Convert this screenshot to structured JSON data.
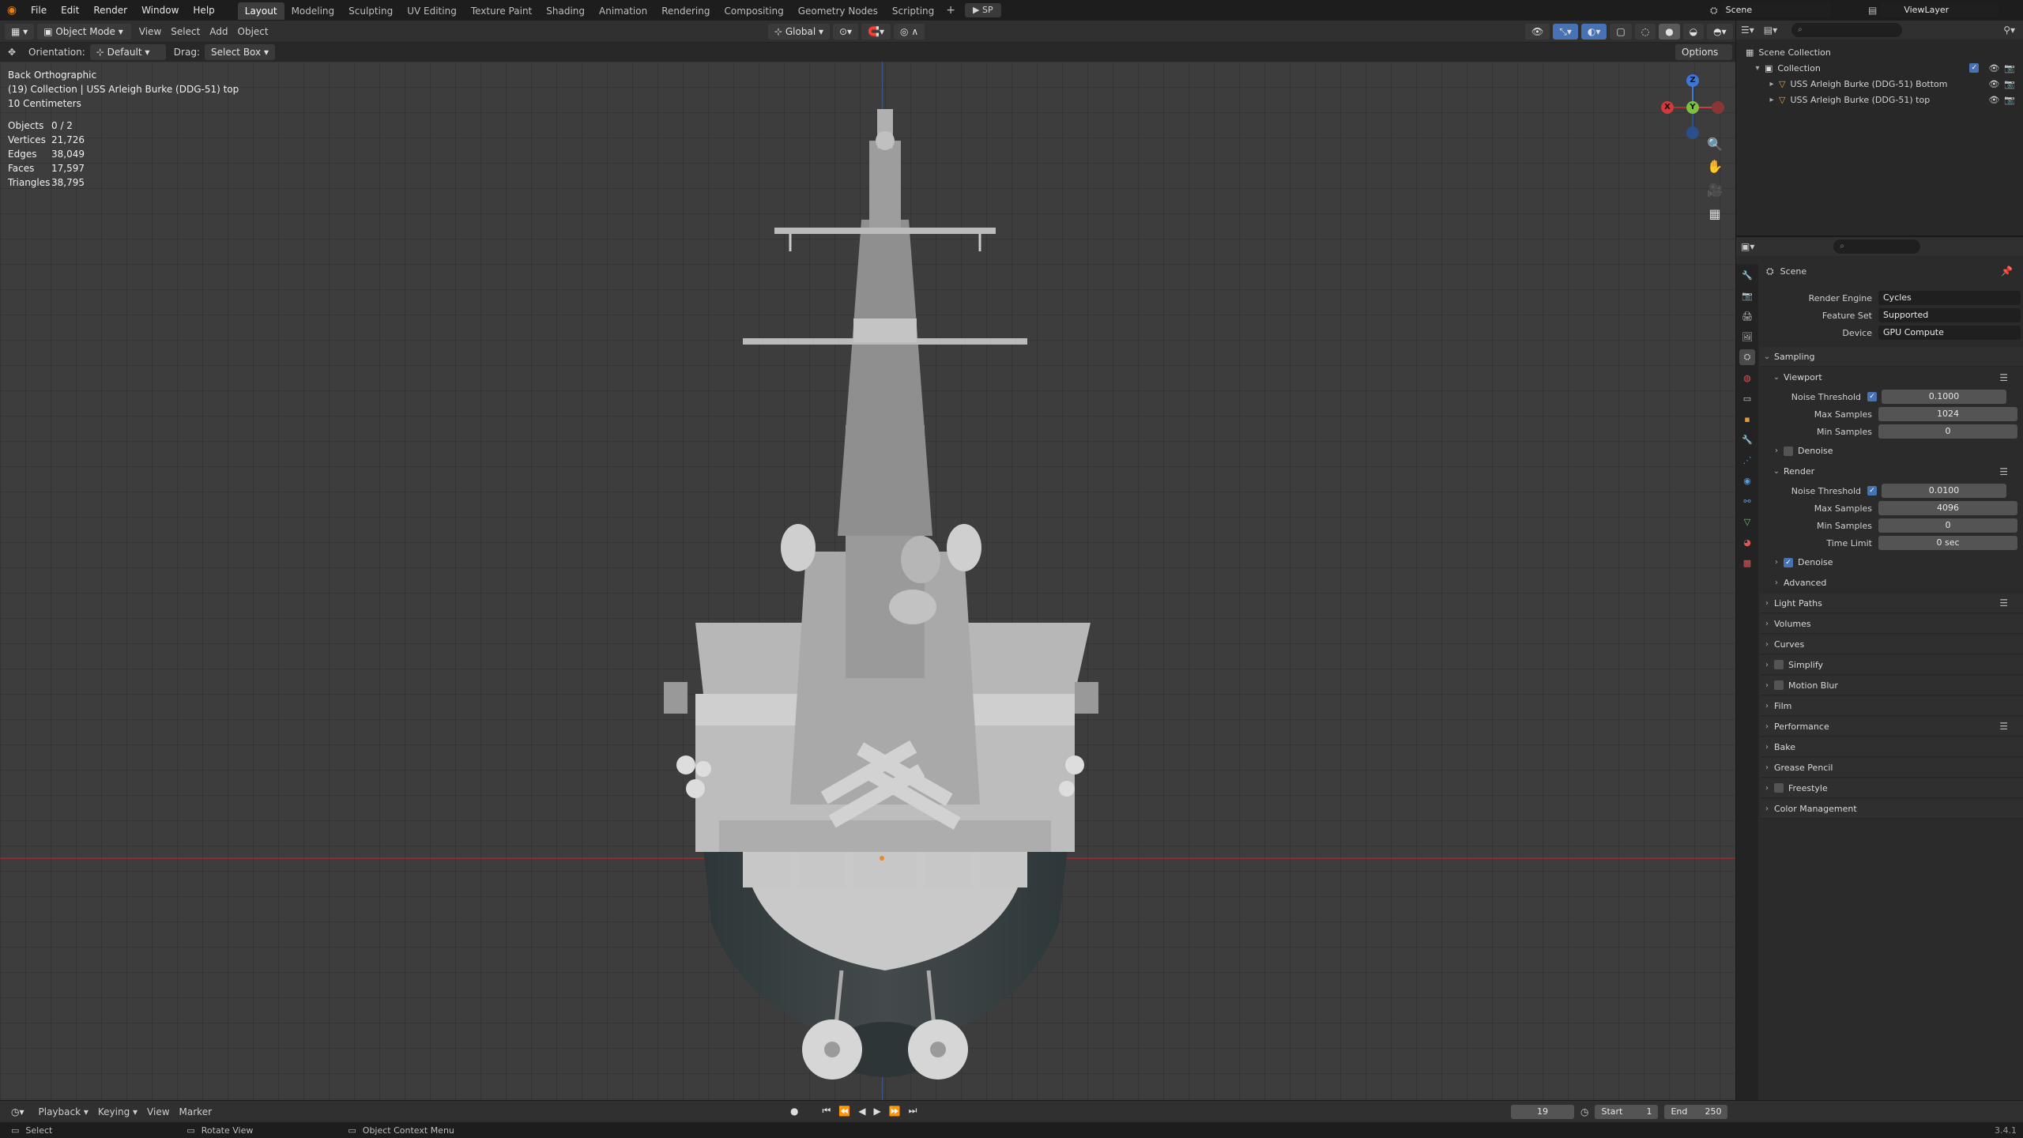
{
  "menu": [
    "File",
    "Edit",
    "Render",
    "Window",
    "Help"
  ],
  "workspaces": [
    "Layout",
    "Modeling",
    "Sculpting",
    "UV Editing",
    "Texture Paint",
    "Shading",
    "Animation",
    "Rendering",
    "Compositing",
    "Geometry Nodes",
    "Scripting"
  ],
  "active_workspace": "Layout",
  "top_right": {
    "scene": "Scene",
    "viewlayer": "ViewLayer",
    "sp_label": "SP"
  },
  "header": {
    "mode": "Object Mode",
    "view": "View",
    "select": "Select",
    "add": "Add",
    "object": "Object",
    "transform": "Global",
    "options": "Options"
  },
  "tool": {
    "orientation_label": "Orientation:",
    "orientation_value": "Default",
    "drag_label": "Drag:",
    "drag_value": "Select Box"
  },
  "overlay": {
    "view_name": "Back Orthographic",
    "collection": "(19) Collection | USS Arleigh Burke (DDG-51) top",
    "scale": "10 Centimeters",
    "stats": [
      {
        "k": "Objects",
        "v": "0 / 2"
      },
      {
        "k": "Vertices",
        "v": "21,726"
      },
      {
        "k": "Edges",
        "v": "38,049"
      },
      {
        "k": "Faces",
        "v": "17,597"
      },
      {
        "k": "Triangles",
        "v": "38,795"
      }
    ]
  },
  "gizmo": {
    "z": "Z",
    "y": "Y",
    "x": "X"
  },
  "outliner": {
    "root": "Scene Collection",
    "collection": "Collection",
    "items": [
      "USS Arleigh Burke (DDG-51) Bottom",
      "USS Arleigh Burke (DDG-51) top"
    ]
  },
  "props": {
    "context": "Scene",
    "render_engine": {
      "label": "Render Engine",
      "value": "Cycles"
    },
    "feature_set": {
      "label": "Feature Set",
      "value": "Supported"
    },
    "device": {
      "label": "Device",
      "value": "GPU Compute"
    },
    "sampling": "Sampling",
    "viewport": "Viewport",
    "vp_noise": {
      "label": "Noise Threshold",
      "value": "0.1000"
    },
    "vp_max": {
      "label": "Max Samples",
      "value": "1024"
    },
    "vp_min": {
      "label": "Min Samples",
      "value": "0"
    },
    "denoise1": "Denoise",
    "render": "Render",
    "r_noise": {
      "label": "Noise Threshold",
      "value": "0.0100"
    },
    "r_max": {
      "label": "Max Samples",
      "value": "4096"
    },
    "r_min": {
      "label": "Min Samples",
      "value": "0"
    },
    "r_time": {
      "label": "Time Limit",
      "value": "0 sec"
    },
    "denoise2": "Denoise",
    "advanced": "Advanced",
    "panels": [
      "Light Paths",
      "Volumes",
      "Curves",
      "Simplify",
      "Motion Blur",
      "Film",
      "Performance",
      "Bake",
      "Grease Pencil",
      "Freestyle",
      "Color Management"
    ]
  },
  "timeline": {
    "playback": "Playback",
    "keying": "Keying",
    "view": "View",
    "marker": "Marker",
    "frame": "19",
    "start_label": "Start",
    "start": "1",
    "end_label": "End",
    "end": "250"
  },
  "status": {
    "select": "Select",
    "rotate": "Rotate View",
    "context": "Object Context Menu",
    "version": "3.4.1"
  }
}
